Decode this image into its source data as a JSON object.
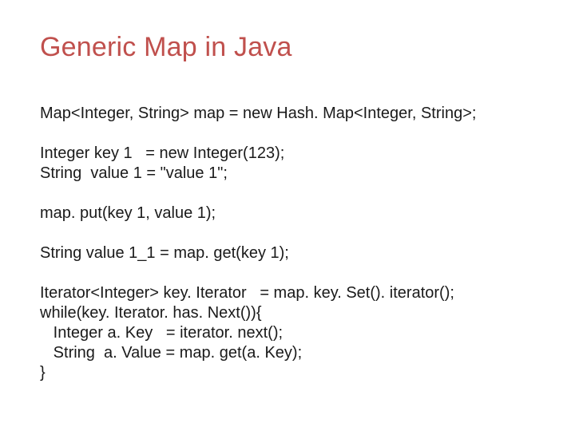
{
  "title": "Generic Map in Java",
  "code": {
    "l1": "Map<Integer, String> map = new Hash. Map<Integer, String>;",
    "l2": "",
    "l3": "Integer key 1   = new Integer(123);",
    "l4": "String  value 1 = \"value 1\";",
    "l5": "",
    "l6": "map. put(key 1, value 1);",
    "l7": "",
    "l8": "String value 1_1 = map. get(key 1);",
    "l9": "",
    "l10": "Iterator<Integer> key. Iterator   = map. key. Set(). iterator();",
    "l11": "while(key. Iterator. has. Next()){",
    "l12": "   Integer a. Key   = iterator. next();",
    "l13": "   String  a. Value = map. get(a. Key);",
    "l14": "}"
  }
}
